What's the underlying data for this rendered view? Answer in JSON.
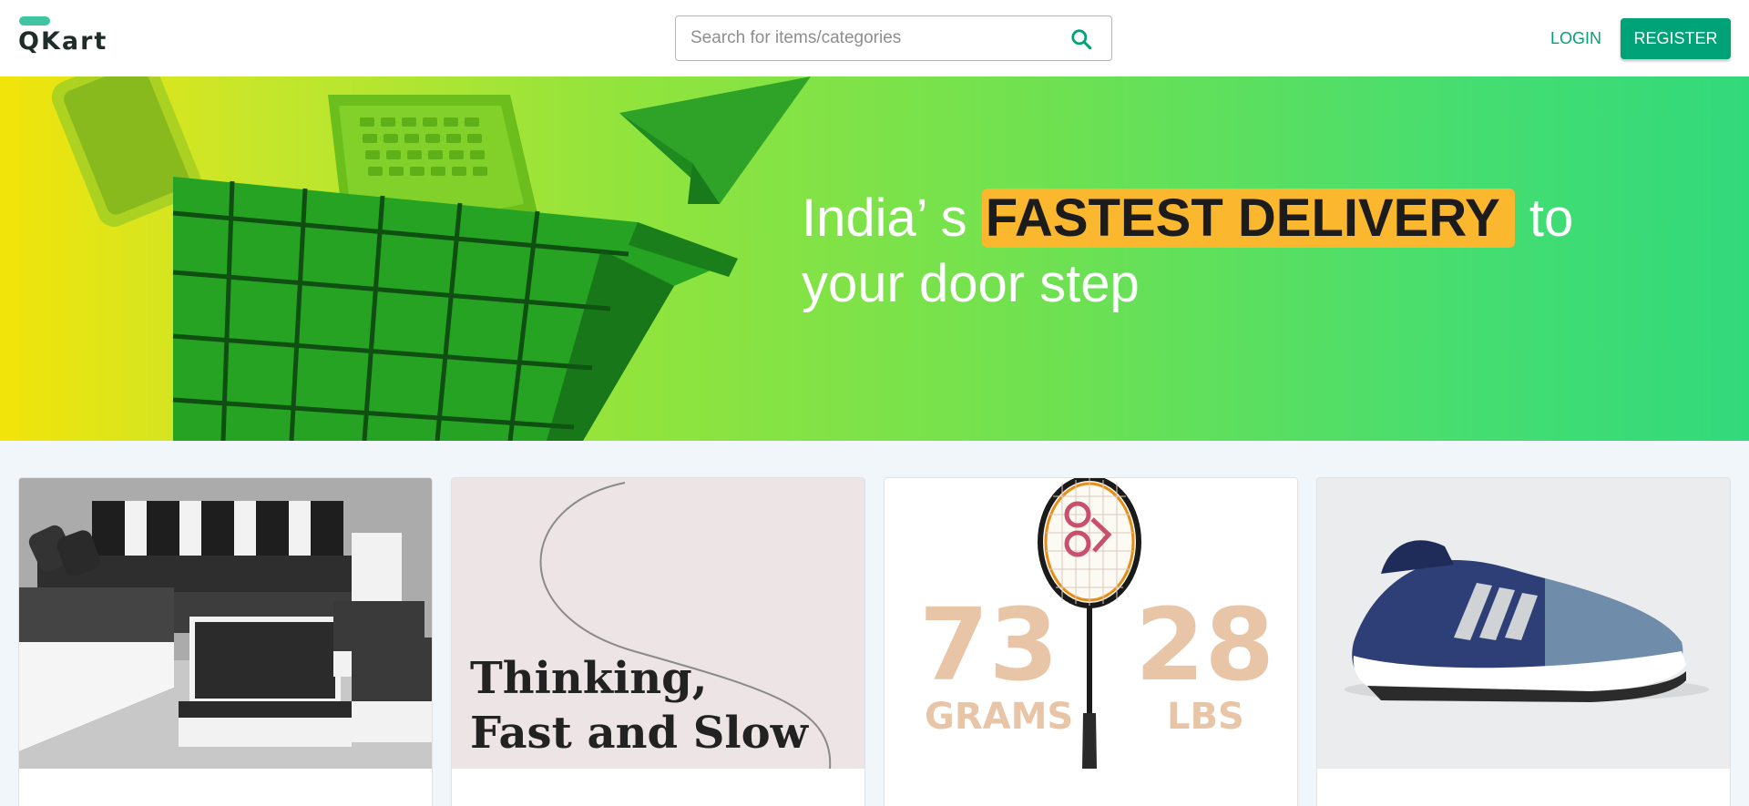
{
  "header": {
    "logo_text": "QKart",
    "search_placeholder": "Search for items/categories",
    "login_label": "LOGIN",
    "register_label": "REGISTER",
    "search_icon": "search-icon"
  },
  "hero": {
    "text_before": "India’ s ",
    "highlight": "FASTEST DELIVERY",
    "text_after": " to",
    "line2": "your door step"
  },
  "products": [
    {
      "image": "sofa-set"
    },
    {
      "image": "book-cover",
      "book_title_line1": "Thinking,",
      "book_title_line2": "Fast and Slow"
    },
    {
      "image": "badminton-racket",
      "left_value": "73",
      "left_unit": "GRAMS",
      "right_value": "28",
      "right_unit": "LBS"
    },
    {
      "image": "running-shoe"
    }
  ],
  "colors": {
    "brand": "#00a278",
    "logo_accent": "#3fc6a0",
    "highlight": "#fbb72e",
    "background": "#f0f6fa"
  }
}
